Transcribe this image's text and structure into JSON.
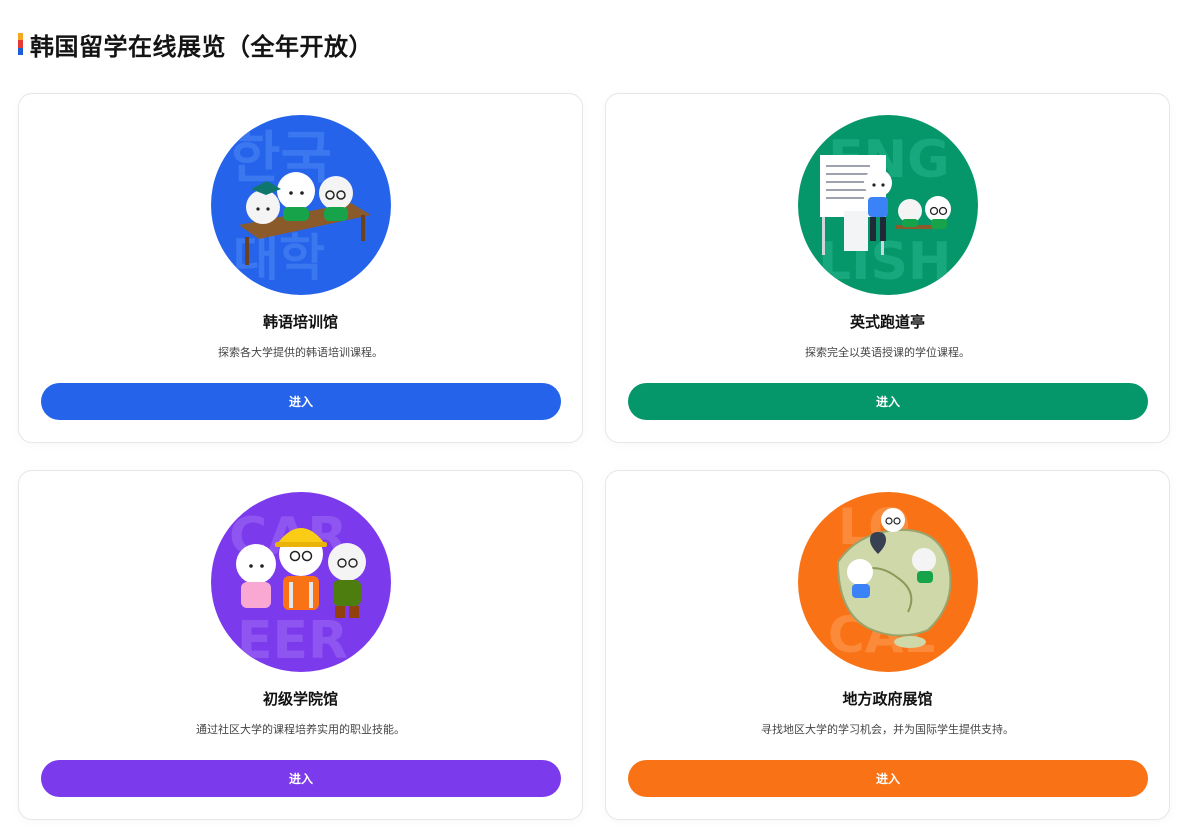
{
  "page": {
    "title": "韩国留学在线展览（全年开放）",
    "accent_colors": [
      "#f5a623",
      "#e53935",
      "#1e5fd8"
    ]
  },
  "cards": [
    {
      "title": "韩语培训馆",
      "description": "探索各大学提供的韩语培训课程。",
      "button_label": "进入",
      "color": "#2563eb",
      "image": "korean-class-illustration"
    },
    {
      "title": "英式跑道亭",
      "description": "探索完全以英语授课的学位课程。",
      "button_label": "进入",
      "color": "#059669",
      "image": "english-class-illustration"
    },
    {
      "title": "初级学院馆",
      "description": "通过社区大学的课程培养实用的职业技能。",
      "button_label": "进入",
      "color": "#7c3aed",
      "image": "career-workers-illustration"
    },
    {
      "title": "地方政府展馆",
      "description": "寻找地区大学的学习机会，并为国际学生提供支持。",
      "button_label": "进入",
      "color": "#f97316",
      "image": "korea-map-illustration"
    }
  ]
}
